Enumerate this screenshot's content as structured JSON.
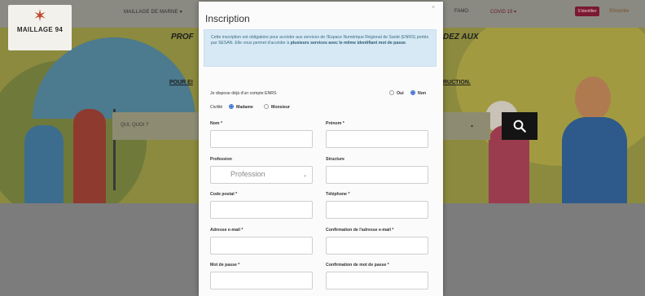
{
  "site": {
    "logo_mark": "✶",
    "logo_text": "MAILLAGE 94",
    "nav_left": "MAILLAGE DE MARNE ▾",
    "nav_right_1": "FAMO",
    "nav_right_2": "COVID 19 ▾",
    "identify_button": "S'identifier",
    "nav_right_3": "S'inscrire",
    "hero_text_left": "PROF",
    "hero_text_right": "DEZ AUX",
    "hero_link_left": "POUR EI",
    "hero_link_right": "RUCTION.",
    "search_placeholder": "QUI, QUOI ?",
    "search_caret": "▾"
  },
  "modal": {
    "title": "Inscription",
    "close": "×",
    "info": {
      "part1": "Cette inscription est obligatoire pour accéder aux services de l'Espace Numérique Régional de Santé (ENRS) portés par SESAN. Elle vous permet d'accéder à ",
      "bold": "plusieurs services avec le même identifiant mot de passe",
      "part2": "."
    },
    "enrs_question": "Je dispose déjà d'un compte ENRS",
    "enrs_yes": "Oui",
    "enrs_no": "Non",
    "civility_label": "Civilité",
    "civility_madame": "Madame",
    "civility_monsieur": "Monsieur",
    "fields": {
      "nom": "Nom *",
      "prenom": "Prénom *",
      "profession": "Profession",
      "profession_placeholder": "Profession",
      "structure": "Structure",
      "code_postal": "Code postal *",
      "telephone": "Téléphone *",
      "email": "Adresse e-mail *",
      "email_confirm": "Confirmation de l'adresse e-mail *",
      "password": "Mot de passe *",
      "password_confirm": "Confirmation de mot de passe *"
    },
    "select_chevron": "⌄"
  },
  "colors": {
    "accent_blue": "#3b6fd0",
    "info_bg": "#d6e9f4",
    "identify_btn": "#7a1930"
  }
}
